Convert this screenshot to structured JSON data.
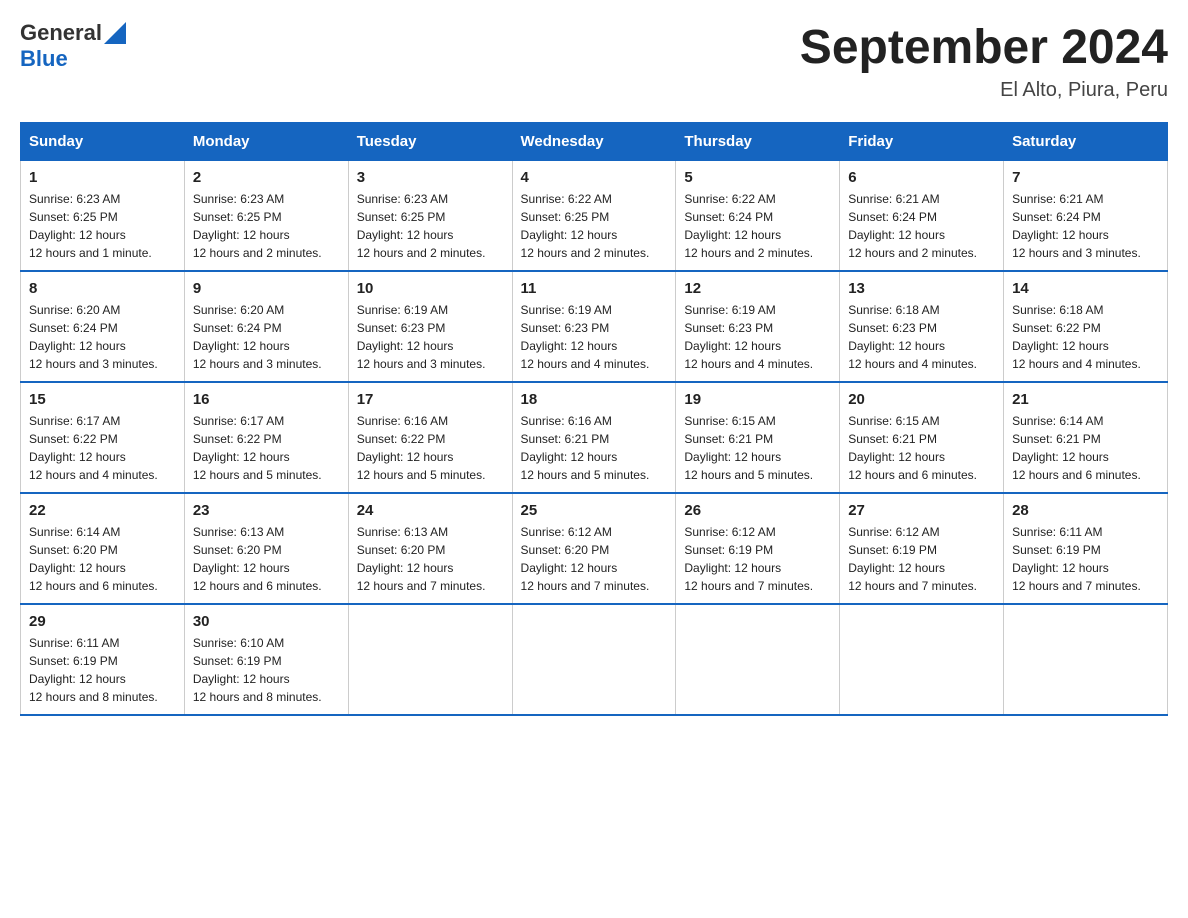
{
  "header": {
    "logo_general": "General",
    "logo_blue": "Blue",
    "title": "September 2024",
    "subtitle": "El Alto, Piura, Peru"
  },
  "days_of_week": [
    "Sunday",
    "Monday",
    "Tuesday",
    "Wednesday",
    "Thursday",
    "Friday",
    "Saturday"
  ],
  "weeks": [
    [
      {
        "day": "1",
        "sunrise": "6:23 AM",
        "sunset": "6:25 PM",
        "daylight": "12 hours and 1 minute."
      },
      {
        "day": "2",
        "sunrise": "6:23 AM",
        "sunset": "6:25 PM",
        "daylight": "12 hours and 2 minutes."
      },
      {
        "day": "3",
        "sunrise": "6:23 AM",
        "sunset": "6:25 PM",
        "daylight": "12 hours and 2 minutes."
      },
      {
        "day": "4",
        "sunrise": "6:22 AM",
        "sunset": "6:25 PM",
        "daylight": "12 hours and 2 minutes."
      },
      {
        "day": "5",
        "sunrise": "6:22 AM",
        "sunset": "6:24 PM",
        "daylight": "12 hours and 2 minutes."
      },
      {
        "day": "6",
        "sunrise": "6:21 AM",
        "sunset": "6:24 PM",
        "daylight": "12 hours and 2 minutes."
      },
      {
        "day": "7",
        "sunrise": "6:21 AM",
        "sunset": "6:24 PM",
        "daylight": "12 hours and 3 minutes."
      }
    ],
    [
      {
        "day": "8",
        "sunrise": "6:20 AM",
        "sunset": "6:24 PM",
        "daylight": "12 hours and 3 minutes."
      },
      {
        "day": "9",
        "sunrise": "6:20 AM",
        "sunset": "6:24 PM",
        "daylight": "12 hours and 3 minutes."
      },
      {
        "day": "10",
        "sunrise": "6:19 AM",
        "sunset": "6:23 PM",
        "daylight": "12 hours and 3 minutes."
      },
      {
        "day": "11",
        "sunrise": "6:19 AM",
        "sunset": "6:23 PM",
        "daylight": "12 hours and 4 minutes."
      },
      {
        "day": "12",
        "sunrise": "6:19 AM",
        "sunset": "6:23 PM",
        "daylight": "12 hours and 4 minutes."
      },
      {
        "day": "13",
        "sunrise": "6:18 AM",
        "sunset": "6:23 PM",
        "daylight": "12 hours and 4 minutes."
      },
      {
        "day": "14",
        "sunrise": "6:18 AM",
        "sunset": "6:22 PM",
        "daylight": "12 hours and 4 minutes."
      }
    ],
    [
      {
        "day": "15",
        "sunrise": "6:17 AM",
        "sunset": "6:22 PM",
        "daylight": "12 hours and 4 minutes."
      },
      {
        "day": "16",
        "sunrise": "6:17 AM",
        "sunset": "6:22 PM",
        "daylight": "12 hours and 5 minutes."
      },
      {
        "day": "17",
        "sunrise": "6:16 AM",
        "sunset": "6:22 PM",
        "daylight": "12 hours and 5 minutes."
      },
      {
        "day": "18",
        "sunrise": "6:16 AM",
        "sunset": "6:21 PM",
        "daylight": "12 hours and 5 minutes."
      },
      {
        "day": "19",
        "sunrise": "6:15 AM",
        "sunset": "6:21 PM",
        "daylight": "12 hours and 5 minutes."
      },
      {
        "day": "20",
        "sunrise": "6:15 AM",
        "sunset": "6:21 PM",
        "daylight": "12 hours and 6 minutes."
      },
      {
        "day": "21",
        "sunrise": "6:14 AM",
        "sunset": "6:21 PM",
        "daylight": "12 hours and 6 minutes."
      }
    ],
    [
      {
        "day": "22",
        "sunrise": "6:14 AM",
        "sunset": "6:20 PM",
        "daylight": "12 hours and 6 minutes."
      },
      {
        "day": "23",
        "sunrise": "6:13 AM",
        "sunset": "6:20 PM",
        "daylight": "12 hours and 6 minutes."
      },
      {
        "day": "24",
        "sunrise": "6:13 AM",
        "sunset": "6:20 PM",
        "daylight": "12 hours and 7 minutes."
      },
      {
        "day": "25",
        "sunrise": "6:12 AM",
        "sunset": "6:20 PM",
        "daylight": "12 hours and 7 minutes."
      },
      {
        "day": "26",
        "sunrise": "6:12 AM",
        "sunset": "6:19 PM",
        "daylight": "12 hours and 7 minutes."
      },
      {
        "day": "27",
        "sunrise": "6:12 AM",
        "sunset": "6:19 PM",
        "daylight": "12 hours and 7 minutes."
      },
      {
        "day": "28",
        "sunrise": "6:11 AM",
        "sunset": "6:19 PM",
        "daylight": "12 hours and 7 minutes."
      }
    ],
    [
      {
        "day": "29",
        "sunrise": "6:11 AM",
        "sunset": "6:19 PM",
        "daylight": "12 hours and 8 minutes."
      },
      {
        "day": "30",
        "sunrise": "6:10 AM",
        "sunset": "6:19 PM",
        "daylight": "12 hours and 8 minutes."
      },
      null,
      null,
      null,
      null,
      null
    ]
  ]
}
